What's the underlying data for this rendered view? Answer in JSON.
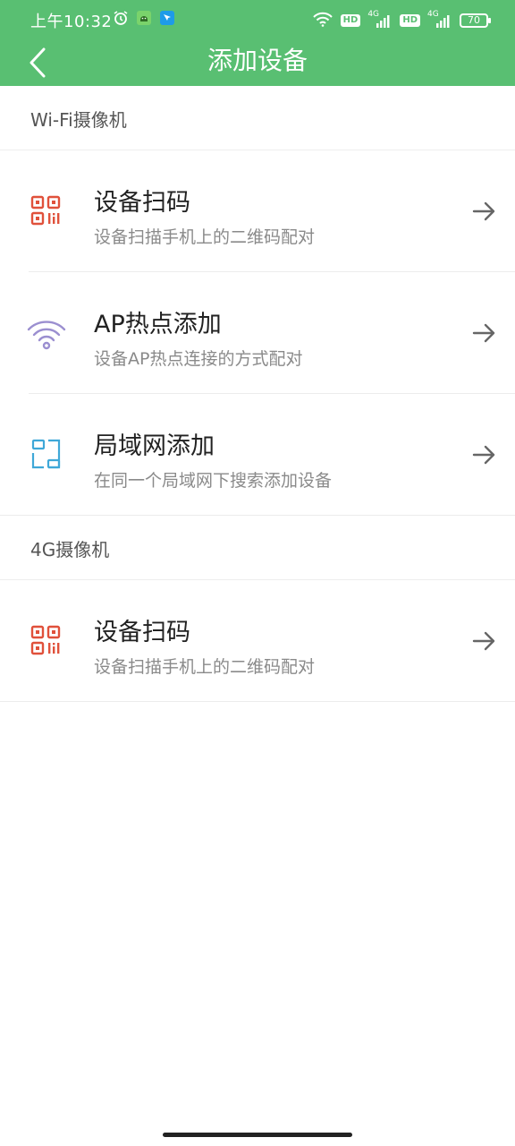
{
  "status_bar": {
    "time": "上午10:32",
    "hd1": "HD",
    "hd2": "HD",
    "net1": "4G",
    "net2": "4G",
    "battery": "70",
    "icons": [
      "alarm-icon",
      "android-app-icon",
      "cursor-app-icon",
      "wifi-icon",
      "signal-icon"
    ]
  },
  "app_bar": {
    "title": "添加设备"
  },
  "sections": [
    {
      "header": "Wi-Fi摄像机",
      "items": [
        {
          "title": "设备扫码",
          "subtitle": "设备扫描手机上的二维码配对",
          "icon": "qr-code-icon"
        },
        {
          "title": "AP热点添加",
          "subtitle": "设备AP热点连接的方式配对",
          "icon": "wifi-icon"
        },
        {
          "title": "局域网添加",
          "subtitle": "在同一个局域网下搜索添加设备",
          "icon": "lan-icon"
        }
      ]
    },
    {
      "header": "4G摄像机",
      "items": [
        {
          "title": "设备扫码",
          "subtitle": "设备扫描手机上的二维码配对",
          "icon": "qr-code-icon"
        }
      ]
    }
  ],
  "colors": {
    "accent": "#59bf72",
    "qr_icon": "#e0513b",
    "wifi_icon": "#9b8fd0",
    "lan_icon": "#3fa8d8",
    "arrow": "#666666"
  }
}
